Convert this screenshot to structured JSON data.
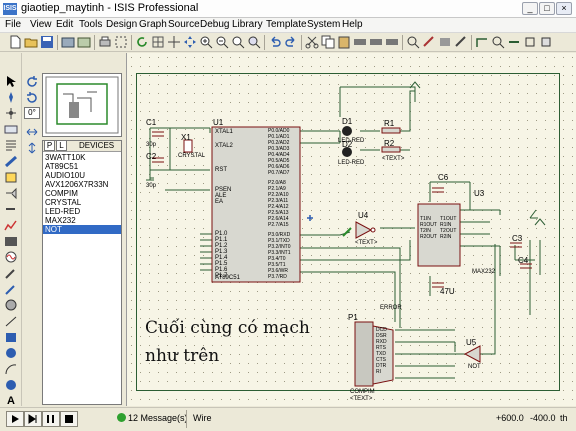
{
  "window": {
    "title": "giaotiep_maytinh - ISIS Professional",
    "icon_text": "ISIS"
  },
  "window_buttons": {
    "minimize": "_",
    "maximize": "□",
    "close": "×"
  },
  "menu": [
    "File",
    "View",
    "Edit",
    "Tools",
    "Design",
    "Graph",
    "Source",
    "Debug",
    "Library",
    "Template",
    "System",
    "Help"
  ],
  "rotation": {
    "angle_value": "0°"
  },
  "devices": {
    "tab_p": "P",
    "tab_l": "L",
    "header": "DEVICES",
    "items": [
      "3WATT10K",
      "AT89C51",
      "AUDIO10U",
      "AVX1206X7R33N",
      "COMPIM",
      "CRYSTAL",
      "LED-RED",
      "MAX232",
      "NOT"
    ],
    "selected_index": 8
  },
  "schematic": {
    "components": {
      "u1": "U1",
      "c1": "C1",
      "c2": "C2",
      "x1": "X1",
      "x1_type": "CRYSTAL",
      "d1": "D1",
      "d1_type": "LED-RED",
      "d2": "D2",
      "d2_type": "LED-RED",
      "r1": "R1",
      "r2": "R2",
      "u4": "U4",
      "u3": "U3",
      "u3_type": "MAX232",
      "c6": "C6",
      "c3": "C3",
      "c4": "C4",
      "c47": "47U",
      "p1": "P1",
      "p1_type": "COMPIM",
      "p1_sub": "ERROR",
      "u5": "U5",
      "u5_type": "NOT",
      "cap_val": "30p",
      "text_placeholder": "<TEXT>"
    },
    "u1_pins_left": [
      "XTAL1",
      "XTAL2",
      "RST",
      "PSEN",
      "ALE",
      "EA",
      "P1.0",
      "P1.1",
      "P1.2",
      "P1.3",
      "P1.4",
      "P1.5",
      "P1.6",
      "P1.7"
    ],
    "u1_pins_right": [
      "P0.0/AD0",
      "P0.1/AD1",
      "P0.2/AD2",
      "P0.3/AD3",
      "P0.4/AD4",
      "P0.5/AD5",
      "P0.6/AD6",
      "P0.7/AD7",
      "P2.0/A8",
      "P2.1/A9",
      "P2.2/A10",
      "P2.3/A11",
      "P2.4/A12",
      "P2.5/A13",
      "P2.6/A14",
      "P2.7/A15",
      "P3.0/RXD",
      "P3.1/TXD",
      "P3.2/INT0",
      "P3.3/INT1",
      "P3.4/T0",
      "P3.5/T1",
      "P3.6/WR",
      "P3.7/RD"
    ],
    "u1_footer": "AT89C51",
    "u3_pins_left": [
      "T1IN",
      "R1OUT",
      "T2IN",
      "R2OUT"
    ],
    "u3_pins_right": [
      "T1OUT",
      "R1IN",
      "T2OUT",
      "R2IN"
    ],
    "p1_pins": [
      "DCD",
      "DSR",
      "RXD",
      "RTS",
      "TXD",
      "CTS",
      "DTR",
      "RI"
    ]
  },
  "annotation": {
    "line1": "Cuối cùng có mạch",
    "line2": "như trên"
  },
  "status": {
    "messages": "12 Message(s)",
    "mode": "Wire",
    "x": "+600.0",
    "y": "-400.0",
    "units": "th"
  },
  "colors": {
    "wire": "#2b5d33",
    "component": "#7a1010",
    "chip_fill": "#d8d8d0",
    "canvas": "#f7f5e6",
    "selection": "#316ac5"
  }
}
